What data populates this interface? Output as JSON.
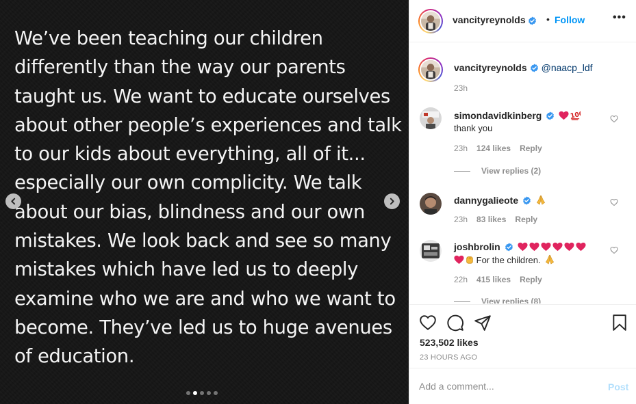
{
  "post": {
    "media_text_lines": [
      "We’ve been teaching our children",
      "differently than the way our parents",
      "taught us. We want to educate ourselves",
      "about other people’s experiences and talk",
      "to our kids about everything, all of it...",
      "especially our own complicity. We talk",
      "about our bias, blindness and our own",
      "mistakes. We look back and see so many",
      "mistakes which have led us to deeply",
      "examine who we are and who we want to",
      "become. They’ve led us to huge avenues",
      "of education."
    ],
    "carousel": {
      "slide_count": 5,
      "active_index": 1
    },
    "prev_icon": "chevron-left-icon",
    "next_icon": "chevron-right-icon"
  },
  "header": {
    "username": "vancityreynolds",
    "dot": "•",
    "follow_label": "Follow",
    "more_label": "•••"
  },
  "caption": {
    "username": "vancityreynolds",
    "mention": "@naacp_ldf",
    "time": "23h"
  },
  "comments": [
    {
      "username": "simondavidkinberg",
      "emoji_inline": [
        "red-heart",
        "hundred-points"
      ],
      "text": "thank you",
      "time": "23h",
      "likes": "124 likes",
      "reply_label": "Reply",
      "view_replies": "View replies (2)"
    },
    {
      "username": "dannygalieote",
      "emoji_inline": [
        "folded-hands"
      ],
      "time": "23h",
      "likes": "83 likes",
      "reply_label": "Reply"
    },
    {
      "username": "joshbrolin",
      "emoji_inline": [
        "red-heart",
        "red-heart",
        "red-heart",
        "red-heart",
        "red-heart",
        "red-heart"
      ],
      "text": "For the children.",
      "time": "22h",
      "likes": "415 likes",
      "reply_label": "Reply",
      "view_replies": "View replies (8)"
    }
  ],
  "actions": {
    "icons": [
      "heart-icon",
      "comment-icon",
      "share-icon",
      "bookmark-icon"
    ],
    "likes": "523,502 likes",
    "time_ago": "23 HOURS AGO"
  },
  "add_comment": {
    "placeholder": "Add a comment...",
    "post_label": "Post"
  },
  "colors": {
    "accent": "#0095f6",
    "verified": "#3897f0",
    "heart_red": "#e0245e",
    "media_bg": "#151515"
  }
}
